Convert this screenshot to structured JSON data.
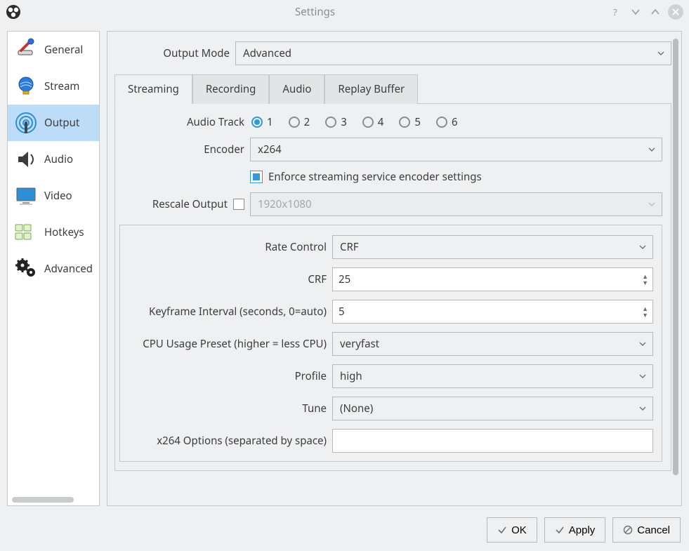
{
  "window": {
    "title": "Settings"
  },
  "sidebar": {
    "items": [
      {
        "label": "General"
      },
      {
        "label": "Stream"
      },
      {
        "label": "Output"
      },
      {
        "label": "Audio"
      },
      {
        "label": "Video"
      },
      {
        "label": "Hotkeys"
      },
      {
        "label": "Advanced"
      }
    ]
  },
  "output_mode": {
    "label": "Output Mode",
    "value": "Advanced"
  },
  "tabs": {
    "streaming": "Streaming",
    "recording": "Recording",
    "audio": "Audio",
    "replay_buffer": "Replay Buffer"
  },
  "streaming": {
    "audio_track": {
      "label": "Audio Track",
      "options": [
        "1",
        "2",
        "3",
        "4",
        "5",
        "6"
      ],
      "selected": "1"
    },
    "encoder": {
      "label": "Encoder",
      "value": "x264"
    },
    "enforce": {
      "label": "Enforce streaming service encoder settings",
      "checked": true
    },
    "rescale": {
      "label": "Rescale Output",
      "checked": false,
      "placeholder": "1920x1080"
    },
    "group": {
      "rate_control": {
        "label": "Rate Control",
        "value": "CRF"
      },
      "crf": {
        "label": "CRF",
        "value": "25"
      },
      "keyframe": {
        "label": "Keyframe Interval (seconds, 0=auto)",
        "value": "5"
      },
      "cpu_preset": {
        "label": "CPU Usage Preset (higher = less CPU)",
        "value": "veryfast"
      },
      "profile": {
        "label": "Profile",
        "value": "high"
      },
      "tune": {
        "label": "Tune",
        "value": "(None)"
      },
      "x264_opts": {
        "label": "x264 Options (separated by space)",
        "value": ""
      }
    }
  },
  "buttons": {
    "ok": "OK",
    "apply": "Apply",
    "cancel": "Cancel"
  }
}
